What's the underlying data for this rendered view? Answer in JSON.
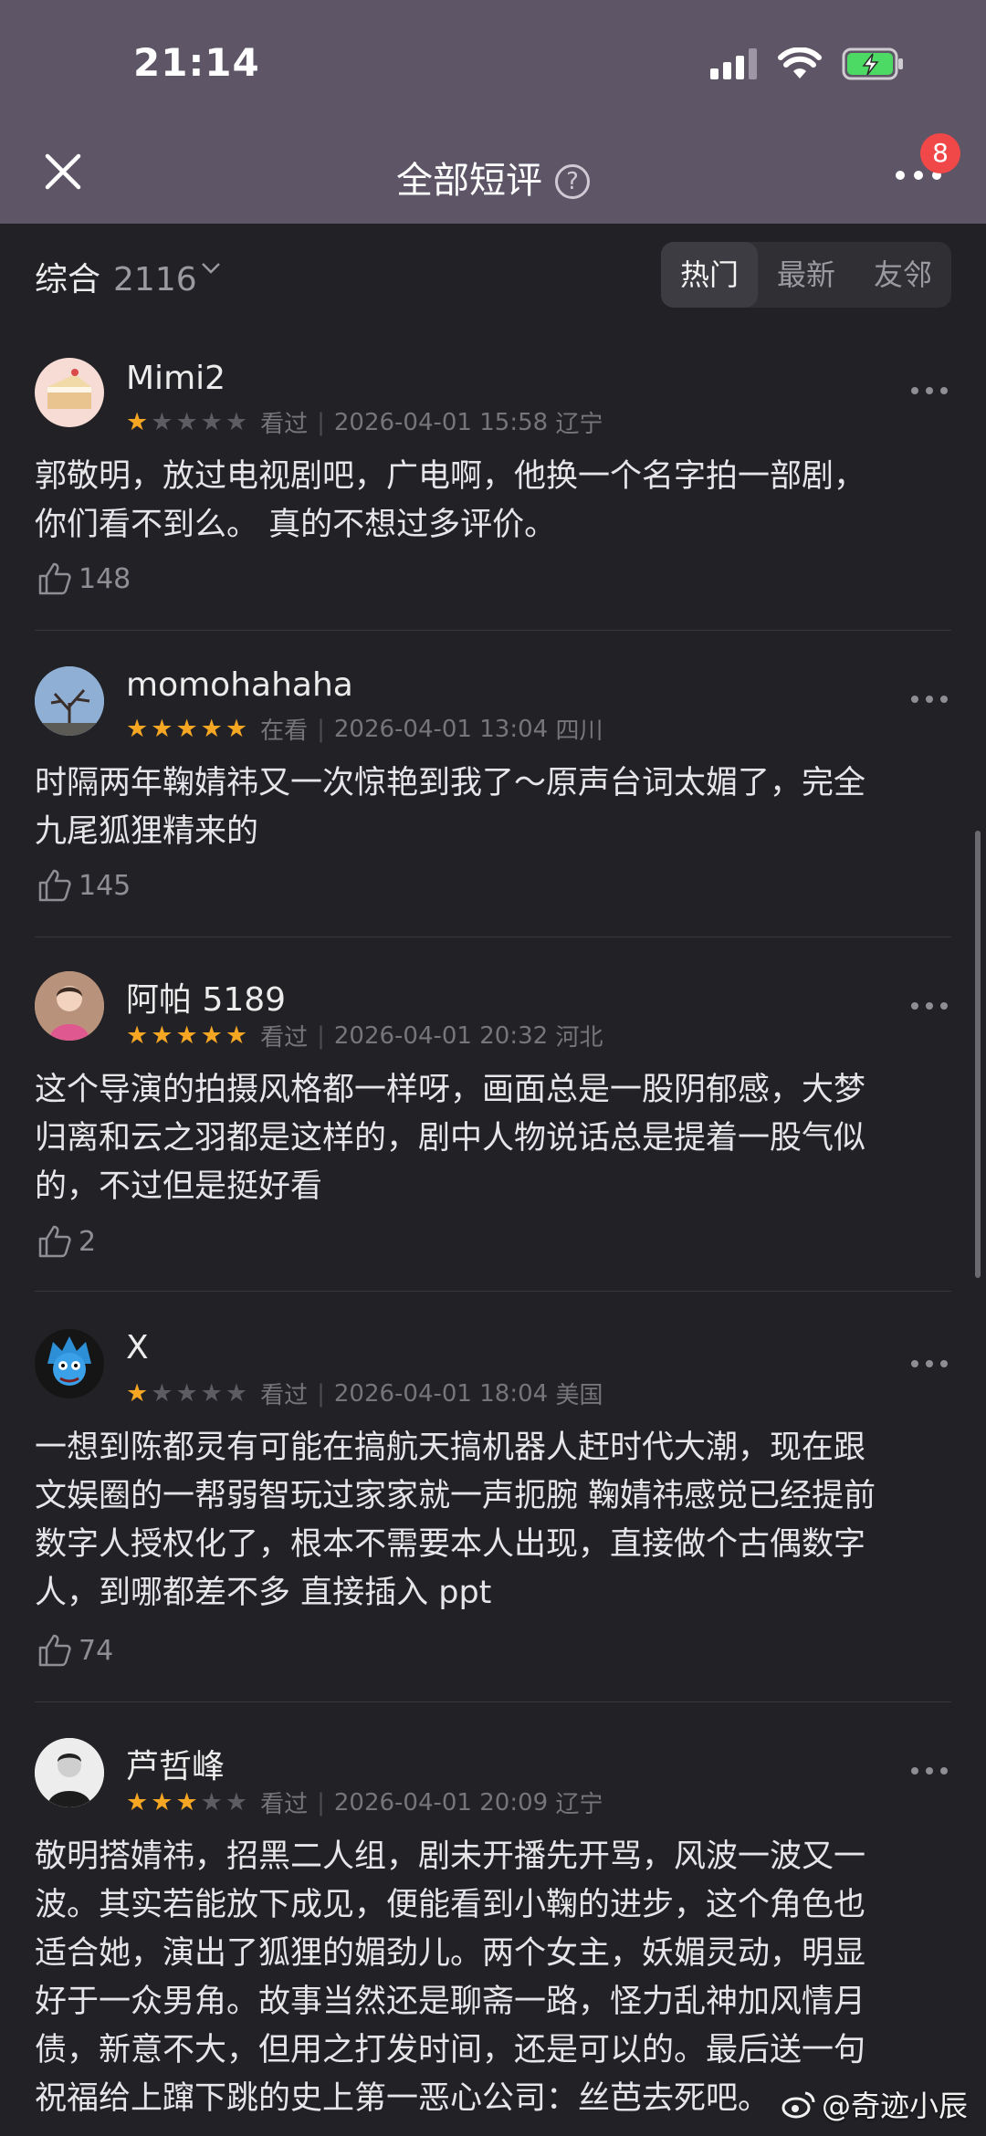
{
  "status_bar": {
    "time": "21:14"
  },
  "header": {
    "title": "全部短评",
    "help_glyph": "?",
    "notification_count": "8"
  },
  "filter": {
    "sort_label": "综合",
    "sort_count": "2116",
    "tabs": [
      {
        "label": "热门",
        "active": true
      },
      {
        "label": "最新",
        "active": false
      },
      {
        "label": "友邻",
        "active": false
      }
    ]
  },
  "reviews": [
    {
      "user": "Mimi2",
      "rating": 1,
      "status": "看过",
      "datetime": "2026-04-01 15:58",
      "location": "辽宁",
      "lines": [
        "郭敬明，放过电视剧吧，广电啊，他换一个名字拍一部剧，",
        "你们看不到么。 真的不想过多评价。"
      ],
      "likes": "148"
    },
    {
      "user": "momohahaha",
      "rating": 5,
      "status": "在看",
      "datetime": "2026-04-01 13:04",
      "location": "四川",
      "lines": [
        "时隔两年鞠婧祎又一次惊艳到我了～原声台词太媚了，完全",
        "九尾狐狸精来的"
      ],
      "likes": "145"
    },
    {
      "user": "阿帕 5189",
      "rating": 5,
      "status": "看过",
      "datetime": "2026-04-01 20:32",
      "location": "河北",
      "lines": [
        "这个导演的拍摄风格都一样呀，画面总是一股阴郁感，大梦",
        "归离和云之羽都是这样的，剧中人物说话总是提着一股气似",
        "的，不过但是挺好看"
      ],
      "likes": "2"
    },
    {
      "user": "X",
      "rating": 1,
      "status": "看过",
      "datetime": "2026-04-01 18:04",
      "location": "美国",
      "lines": [
        "一想到陈都灵有可能在搞航天搞机器人赶时代大潮，现在跟",
        "文娱圈的一帮弱智玩过家家就一声扼腕  鞠婧祎感觉已经提前",
        "数字人授权化了，根本不需要本人出现，直接做个古偶数字",
        "人，到哪都差不多  直接插入 ppt"
      ],
      "likes": "74"
    },
    {
      "user": "芦哲峰",
      "rating": 3,
      "status": "看过",
      "datetime": "2026-04-01 20:09",
      "location": "辽宁",
      "lines": [
        "敬明搭婧祎，招黑二人组，剧未开播先开骂，风波一波又一",
        "波。其实若能放下成见，便能看到小鞠的进步，这个角色也",
        "适合她，演出了狐狸的媚劲儿。两个女主，妖媚灵动，明显",
        "好于一众男角。故事当然还是聊斋一路，怪力乱神加风情月",
        "债，新意不大，但用之打发时间，还是可以的。最后送一句",
        "祝福给上蹿下跳的史上第一恶心公司：丝芭去死吧。"
      ],
      "likes": ""
    }
  ],
  "watermark": "@奇迹小辰",
  "colors": {
    "star_on": "#f5a623",
    "badge": "#f04848",
    "header_bg": "#5e5567",
    "page_bg": "#222226"
  }
}
